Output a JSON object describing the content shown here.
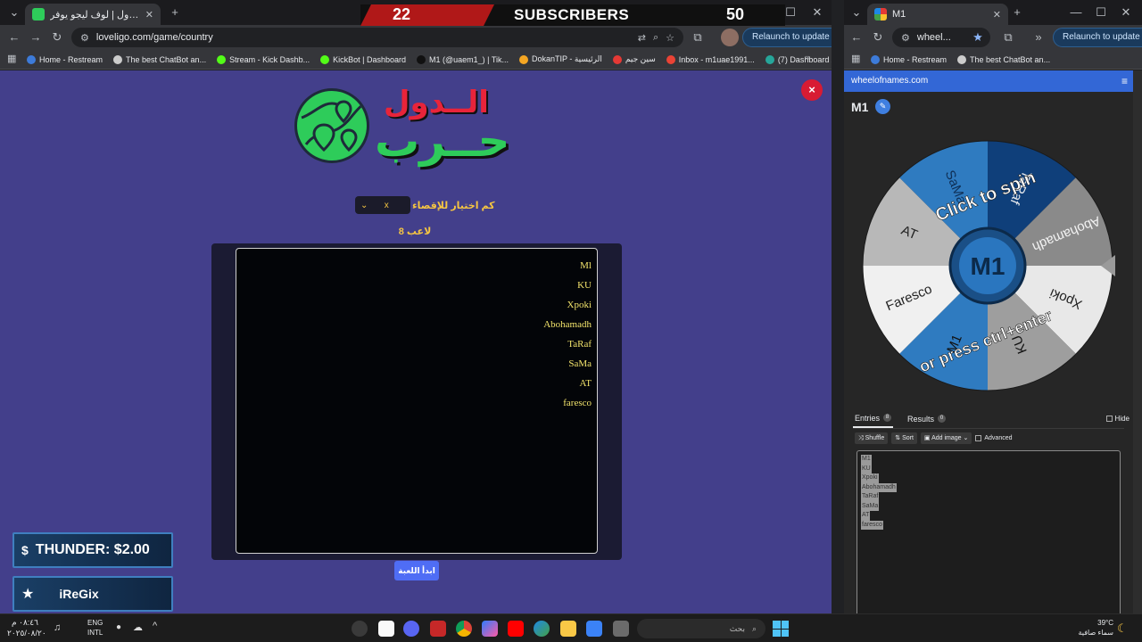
{
  "left_window": {
    "tab_title": "لعبة حرب الدول | لوف ليجو يوفر",
    "url": "loveligo.com/game/country",
    "relaunch_label": "Relaunch to update",
    "bookmarks": [
      {
        "label": "Home - Restream",
        "color": "#3d7bd9"
      },
      {
        "label": "The best ChatBot an...",
        "color": "#cccccc"
      },
      {
        "label": "Stream - Kick Dashb...",
        "color": "#53fc18"
      },
      {
        "label": "KickBot | Dashboard",
        "color": "#53fc18"
      },
      {
        "label": "M1 (@uaem1_) | Tik...",
        "color": "#111111"
      },
      {
        "label": "DokanTIP - الرئيسية",
        "color": "#f5a623"
      },
      {
        "label": "سين جيم",
        "color": "#e53935"
      },
      {
        "label": "Inbox - m1uae1991...",
        "color": "#ea4335"
      },
      {
        "label": "(7) Dashboard / Stre...",
        "color": "#26a69a"
      }
    ]
  },
  "game": {
    "close_label": "×",
    "logo_title_top": "الــدول",
    "logo_title_main": "حــرب",
    "elimination_label": "كم اختيار للإقصاء",
    "elimination_value": "x",
    "player_count_label": "8 لاعب",
    "players": [
      "Ml",
      "KU",
      "Xpoki",
      "Abohamadh",
      "TaRaf",
      "SaMa",
      "AT",
      "faresco"
    ],
    "start_button": "ابدأ اللعبة"
  },
  "overlay": {
    "subs_current": "22",
    "subs_label": "SUBSCRIBERS",
    "subs_goal": "50",
    "alert_top": "THUNDER: $2.00",
    "alert_bottom": "iReGix"
  },
  "right_window": {
    "tab_title": "M1",
    "url": "wheel...",
    "relaunch_label": "Relaunch to update",
    "bookmarks": [
      {
        "label": "Home - Restream",
        "color": "#3d7bd9"
      },
      {
        "label": "The best ChatBot an...",
        "color": "#cccccc"
      }
    ],
    "site_name": "wheelofnames.com",
    "wheel_title": "M1",
    "wheel_prompt_top": "Click to spin",
    "wheel_prompt_bottom": "or press ctrl+enter",
    "wheel_segments": [
      {
        "label": "TaRaf",
        "color": "#0f3f7a",
        "text_color": "#e8eaed"
      },
      {
        "label": "Abohamadh",
        "color": "#8a8a8a",
        "text_color": "#f2f2f2"
      },
      {
        "label": "Xpoki",
        "color": "#e8e8e8",
        "text_color": "#222222"
      },
      {
        "label": "KU",
        "color": "#9e9e9e",
        "text_color": "#111111"
      },
      {
        "label": "M1",
        "color": "#2f7bc0",
        "text_color": "#111111"
      },
      {
        "label": "Faresco",
        "color": "#f0f0f0",
        "text_color": "#222222"
      },
      {
        "label": "AT",
        "color": "#b8b8b8",
        "text_color": "#222222"
      },
      {
        "label": "SaMa",
        "color": "#2f7bc0",
        "text_color": "#0f2f55"
      }
    ],
    "tab_entries": "Entries",
    "tab_entries_count": "8",
    "tab_results": "Results",
    "tab_results_count": "0",
    "hide_label": "Hide",
    "tool_shuffle": "Shuffle",
    "tool_sort": "Sort",
    "tool_add_image": "Add image",
    "tool_advanced": "Advanced",
    "entries": [
      "M1",
      "KU",
      "Xpoki",
      "Abohamadh",
      "TaRaf",
      "SaMa",
      "AT",
      "faresco"
    ]
  },
  "taskbar": {
    "time": "٠٨:٤٦ م",
    "date": "٢٠٢٥/٠٨/٢٠",
    "lang_top": "ENG",
    "lang_bottom": "INTL",
    "search_placeholder": "بحث",
    "weather_temp": "39°C",
    "weather_desc": "سماء صافية"
  }
}
